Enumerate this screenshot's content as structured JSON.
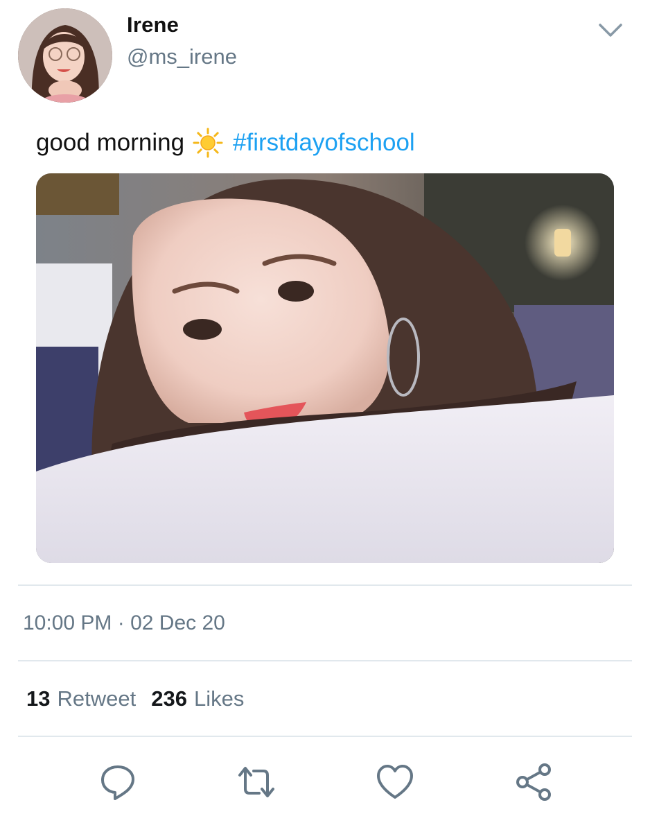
{
  "tweet": {
    "author_name": "Irene",
    "author_handle": "@ms_irene",
    "text": "good morning",
    "emoji_icon": "sun-icon",
    "hashtag": "#firstdayofschool",
    "timestamp": "10:00 PM · 02 Dec 20"
  },
  "stats": {
    "retweets_count": "13",
    "retweets_label": "Retweet",
    "likes_count": "236",
    "likes_label": "Likes"
  },
  "actions": [
    "reply-icon",
    "retweet-icon",
    "like-icon",
    "share-icon"
  ],
  "colors": {
    "link": "#1da1f2",
    "secondary_text": "#657786",
    "divider": "#e1e8ed",
    "icon": "#657786"
  }
}
